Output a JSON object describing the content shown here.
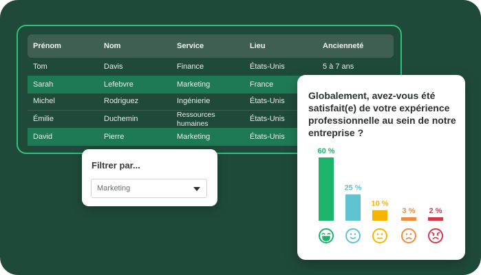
{
  "table": {
    "headers": [
      "Prénom",
      "Nom",
      "Service",
      "Lieu",
      "Ancienneté"
    ],
    "rows": [
      [
        "Tom",
        "Davis",
        "Finance",
        "États-Unis",
        "5 à 7 ans"
      ],
      [
        "Sarah",
        "Lefebvre",
        "Marketing",
        "France",
        ""
      ],
      [
        "Michel",
        "Rodriguez",
        "Ingénierie",
        "États-Unis",
        ""
      ],
      [
        "Émilie",
        "Duchemin",
        "Ressources\nhumaines",
        "États-Unis",
        ""
      ],
      [
        "David",
        "Pierre",
        "Marketing",
        "États-Unis",
        ""
      ]
    ],
    "highlight_color": "#1e7a55",
    "border_color": "#2ec27e"
  },
  "filter": {
    "label": "Filtrer par...",
    "selected": "Marketing"
  },
  "survey": {
    "question": "Globalement, avez-vous été satisfait(e) de votre expérience professionnelle au sein de notre entreprise ?"
  },
  "chart_data": {
    "type": "bar",
    "categories": [
      "très satisfait",
      "satisfait",
      "neutre",
      "insatisfait",
      "très insatisfait"
    ],
    "values": [
      60,
      25,
      10,
      3,
      2
    ],
    "labels": [
      "60 %",
      "25 %",
      "10 %",
      "3 %",
      "2 %"
    ],
    "colors": [
      "#1db36b",
      "#5fc3cf",
      "#f6b400",
      "#f28a3c",
      "#d6384a"
    ],
    "icons": [
      "grin-face-icon",
      "smile-face-icon",
      "neutral-face-icon",
      "frown-face-icon",
      "angry-face-icon"
    ],
    "ylim": [
      0,
      60
    ],
    "title": "",
    "xlabel": "",
    "ylabel": ""
  }
}
